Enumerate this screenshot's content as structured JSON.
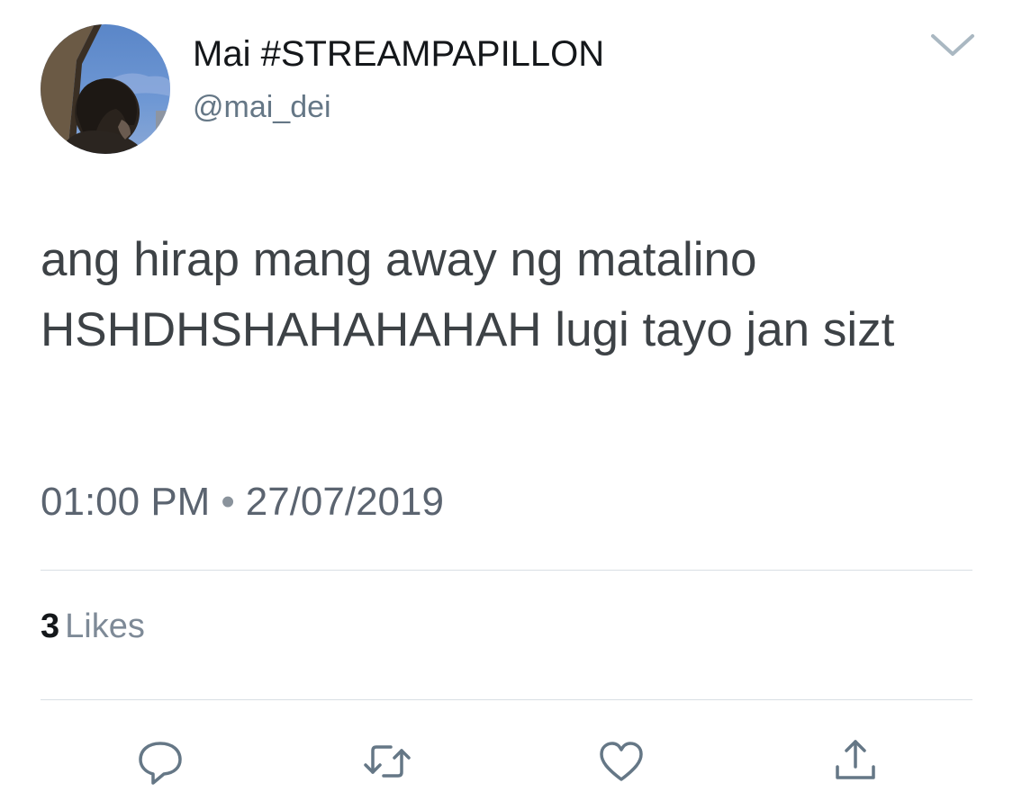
{
  "tweet": {
    "display_name": "Mai #STREAMPAPILLON",
    "handle": "@mai_dei",
    "text": "ang hirap mang away ng matalino HSHDHSHAHAHAHAH lugi tayo jan sizt",
    "time": "01:00 PM",
    "separator": "•",
    "date": "27/07/2019",
    "likes": {
      "count": "3",
      "label": "Likes"
    }
  },
  "icons": {
    "avatar": "profile-photo",
    "caret": "chevron-down-icon",
    "reply": "reply-icon",
    "retweet": "retweet-icon",
    "like": "heart-icon",
    "share": "share-icon"
  },
  "colors": {
    "text_primary": "#14171a",
    "text_secondary": "#657786",
    "icon_gray": "#657786",
    "divider": "#d9dfe4"
  }
}
